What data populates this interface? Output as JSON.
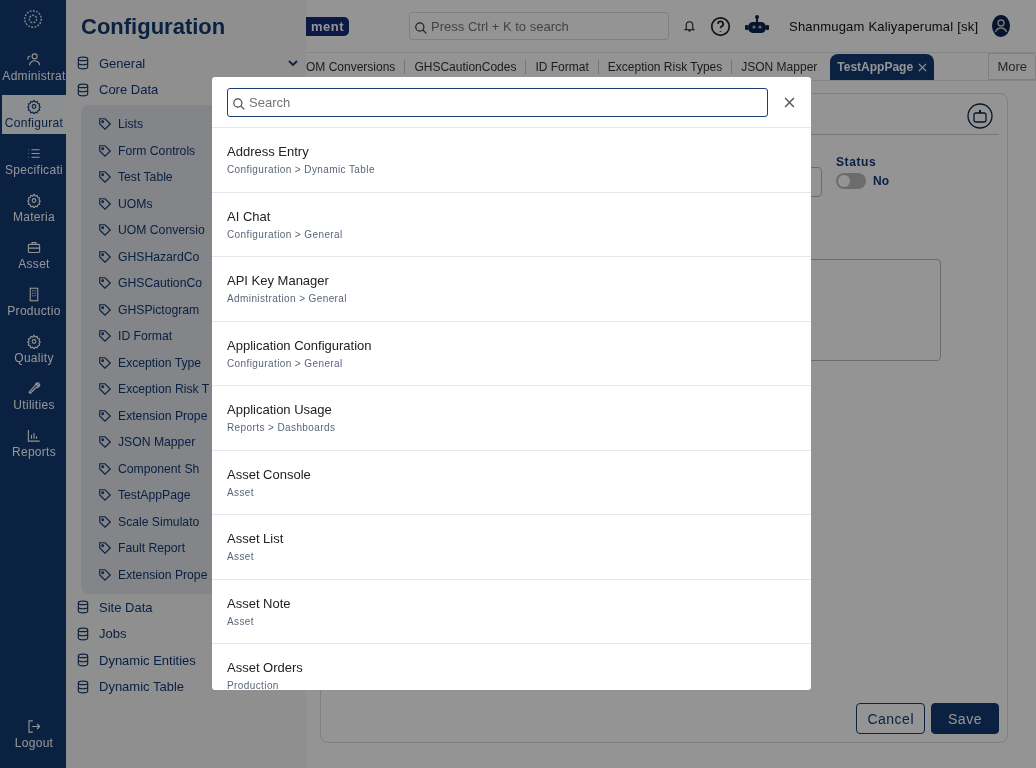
{
  "rail": {
    "items": [
      {
        "label": "Administrat",
        "selected": false
      },
      {
        "label": "Configurat",
        "selected": true
      },
      {
        "label": "Specificati",
        "selected": false
      },
      {
        "label": "Materia",
        "selected": false
      },
      {
        "label": "Asset",
        "selected": false
      },
      {
        "label": "Productio",
        "selected": false
      },
      {
        "label": "Quality",
        "selected": false
      },
      {
        "label": "Utilities",
        "selected": false
      },
      {
        "label": "Reports",
        "selected": false
      }
    ],
    "logout": "Logout"
  },
  "panel": {
    "title": "Configuration",
    "items": [
      {
        "label": "General"
      },
      {
        "label": "Core Data",
        "children": [
          {
            "label": "Lists"
          },
          {
            "label": "Form Controls"
          },
          {
            "label": "Test Table"
          },
          {
            "label": "UOMs"
          },
          {
            "label": "UOM Conversio"
          },
          {
            "label": "GHSHazardCo"
          },
          {
            "label": "GHSCautionCo"
          },
          {
            "label": "GHSPictogram"
          },
          {
            "label": "ID Format"
          },
          {
            "label": "Exception Type"
          },
          {
            "label": "Exception Risk T"
          },
          {
            "label": "Extension Prope"
          },
          {
            "label": "JSON Mapper"
          },
          {
            "label": "Component Sh"
          },
          {
            "label": "TestAppPage"
          },
          {
            "label": "Scale Simulato"
          },
          {
            "label": "Fault Report"
          },
          {
            "label": "Extension Prope"
          }
        ]
      },
      {
        "label": "Site Data"
      },
      {
        "label": "Jobs"
      },
      {
        "label": "Dynamic Entities"
      },
      {
        "label": "Dynamic Table"
      }
    ]
  },
  "topbar": {
    "badge": "ment",
    "search": {
      "placeholder": "Press Ctrl + K to search"
    },
    "user": "Shanmugam Kaliyaperumal [sk]"
  },
  "tabs": [
    {
      "label": "OM Conversions",
      "selected": false
    },
    {
      "label": "GHSCautionCodes",
      "selected": false
    },
    {
      "label": "ID Format",
      "selected": false
    },
    {
      "label": "Exception Risk Types",
      "selected": false
    },
    {
      "label": "JSON Mapper",
      "selected": false
    },
    {
      "label": "TestAppPage",
      "selected": true
    }
  ],
  "more": "More",
  "form": {
    "status": {
      "label": "Status",
      "on": false,
      "value": "No"
    },
    "buttons": {
      "cancel": "Cancel",
      "save": "Save"
    }
  },
  "modal": {
    "search": {
      "placeholder": "Search"
    },
    "results": [
      {
        "title": "Address Entry",
        "path": "Configuration > Dynamic Table"
      },
      {
        "title": "AI Chat",
        "path": "Configuration > General"
      },
      {
        "title": "API Key Manager",
        "path": "Administration > General"
      },
      {
        "title": "Application Configuration",
        "path": "Configuration > General"
      },
      {
        "title": "Application Usage",
        "path": "Reports > Dashboards"
      },
      {
        "title": "Asset Console",
        "path": "Asset"
      },
      {
        "title": "Asset List",
        "path": "Asset"
      },
      {
        "title": "Asset Note",
        "path": "Asset"
      },
      {
        "title": "Asset Orders",
        "path": "Production"
      }
    ]
  }
}
